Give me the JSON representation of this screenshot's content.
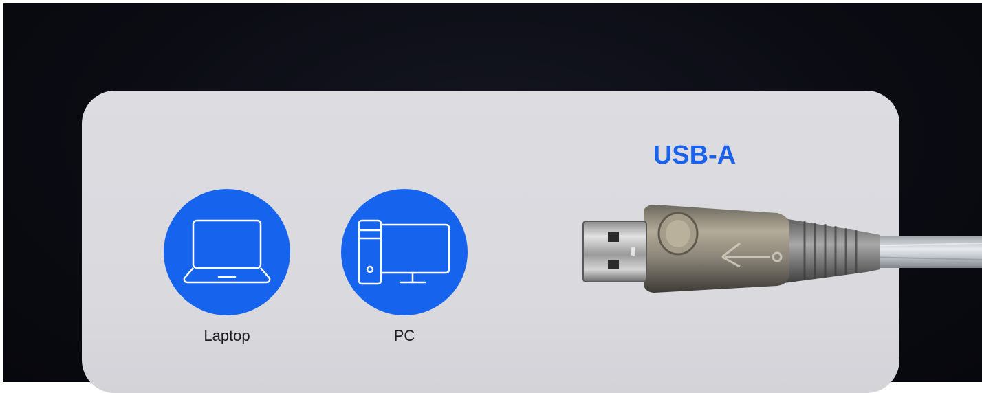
{
  "top_link": {
    "label": ""
  },
  "devices": [
    {
      "label": "Laptop",
      "icon": "laptop-icon"
    },
    {
      "label": "PC",
      "icon": "desktop-pc-icon"
    }
  ],
  "connector": {
    "title": "USB-A",
    "image": "usb-a-cable-plug"
  },
  "colors": {
    "accent": "#1663ee",
    "title_blue": "#1a62ec",
    "card_bg": "#dcdce1",
    "page_bg": "#0b0c13"
  }
}
